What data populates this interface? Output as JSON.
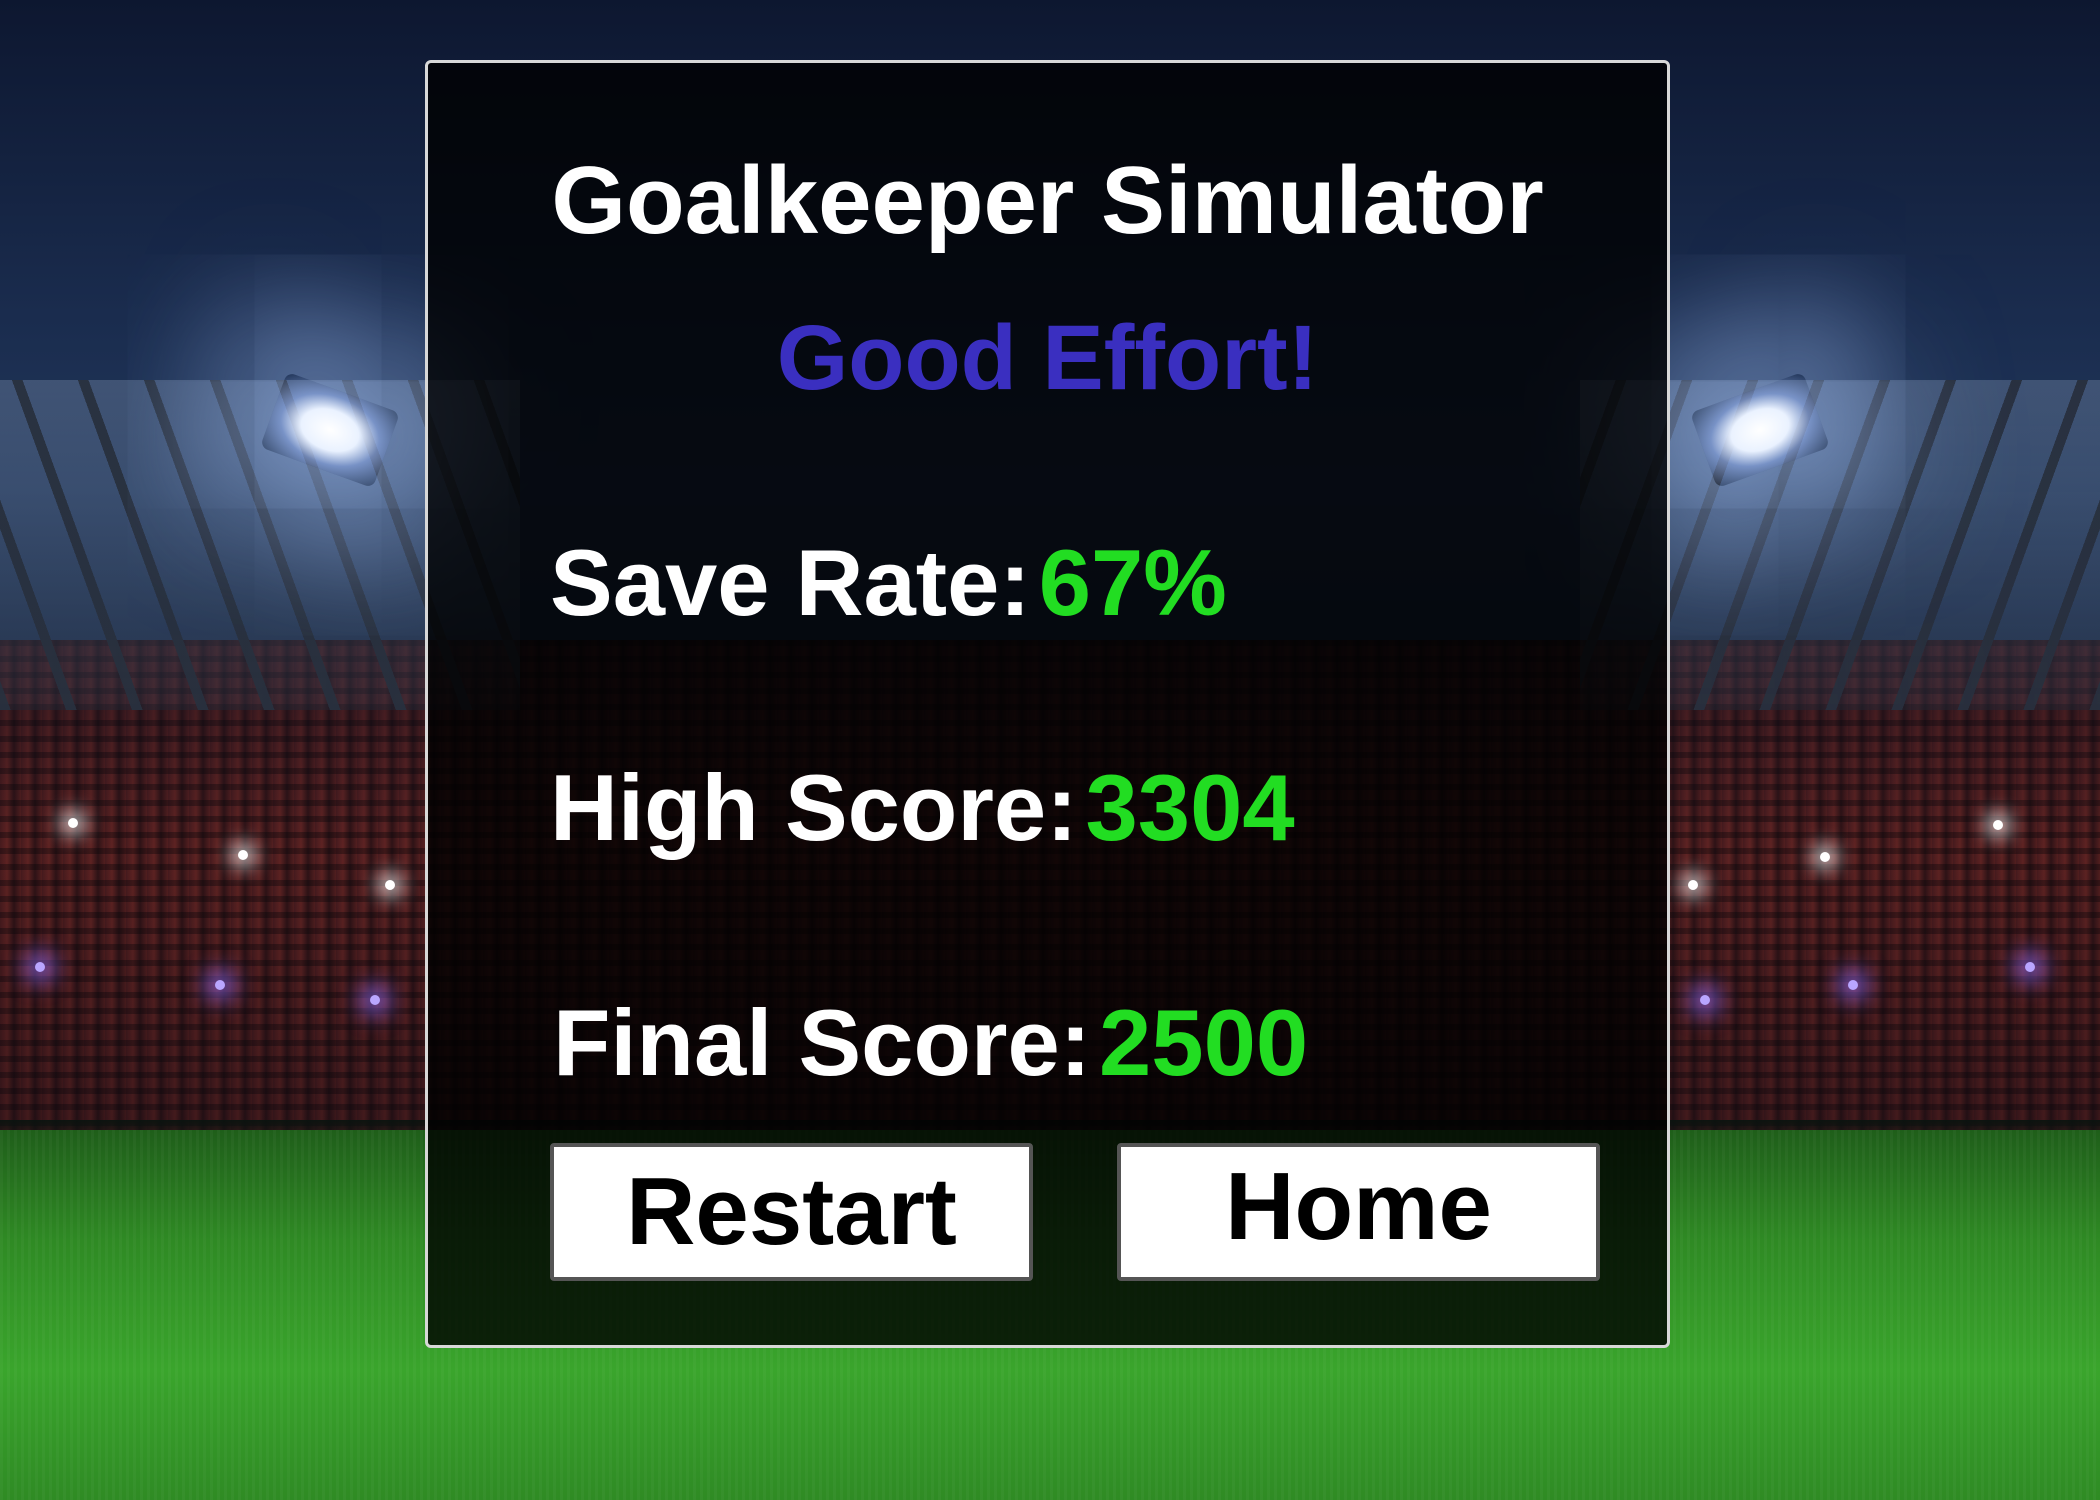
{
  "game": {
    "title": "Goalkeeper Simulator",
    "result_message": "Good Effort!",
    "stats": {
      "save_rate_label": "Save Rate:",
      "save_rate_value": "67%",
      "high_score_label": "High Score:",
      "high_score_value": "3304",
      "final_score_label": "Final Score:",
      "final_score_value": "2500"
    },
    "buttons": {
      "restart_label": "Restart",
      "home_label": "Home"
    }
  },
  "colors": {
    "result_message": "#3a2fc0",
    "stat_value": "#22dd22",
    "label_text": "#ffffff",
    "button_bg": "#ffffff",
    "button_text": "#000000"
  }
}
